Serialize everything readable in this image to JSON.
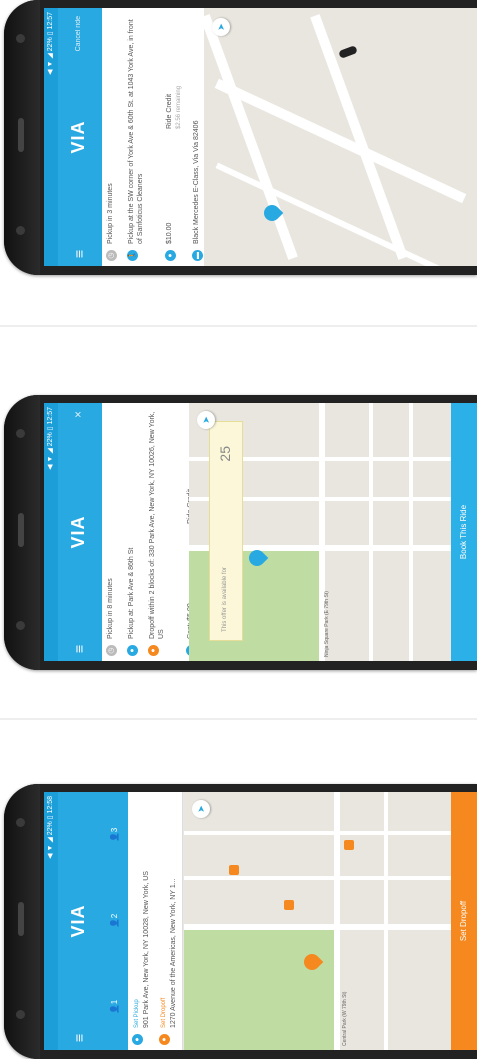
{
  "app": {
    "logo": "VIA"
  },
  "screens": [
    {
      "status_text": "◀ ▼ ◢ 22% ▯ 12:57",
      "appbar_right": "Cancel ride",
      "rows": {
        "pickup_time": "Pickup in 3 minutes",
        "pickup_detail": "Pickup at the SW corner of York Ave & 60th St. at 1043 York Ave, in front of Sanfoticus Cleaners",
        "cost": "$10.00",
        "ride_credit": "Ride Credit",
        "ride_credit_sub": "$2.56 remaining",
        "vehicle": "Black Mercedes E-Class, Via Via 82406"
      },
      "cta": ""
    },
    {
      "status_text": "◀ ▼ ◢ 22% ▯ 12:57",
      "appbar_right": "×",
      "rows": {
        "pickup_time": "Pickup in 8 minutes",
        "pickup_detail": "Pickup at: Park Ave & 86th St",
        "dropoff_detail": "Dropoff within 2 blocks of: 330 Park Ave, New York, NY 10026, New York, US",
        "cost": "Cost: $5.00",
        "ride_credit": "Ride Credit"
      },
      "offer_text": "This offer is available for",
      "offer_num": "25",
      "map_label": "Ninja Square Park (E 79th St)",
      "cta": "Book This Ride"
    },
    {
      "status_text": "◀ ▼ ◢ 22% ▯ 12:58",
      "appbar_right": "",
      "passengers": [
        "1",
        "2",
        "3"
      ],
      "rows": {
        "pickup_label": "Set Pickup",
        "pickup_addr": "901 Park Ave, New York, NY 10028, New York, US",
        "dropoff_label": "Set Dropoff",
        "dropoff_addr": "1270 Avenue of the Americas, New York, NY 1..."
      },
      "map_label": "Central Park (W 79th St)",
      "cta": "Set Dropoff"
    }
  ],
  "colors": {
    "primary": "#29a9e1",
    "accent": "#f5891f",
    "map_bg": "#e9e6df"
  }
}
